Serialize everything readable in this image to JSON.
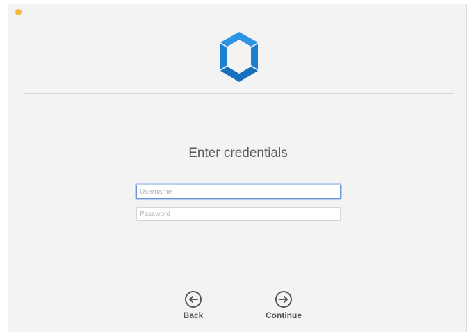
{
  "window": {
    "traffic_light_color": "#f6b93a"
  },
  "brand": {
    "logo_icon": "hexagon-cube-logo-icon",
    "accent_color": "#1e84d6"
  },
  "form": {
    "title": "Enter credentials",
    "username_placeholder": "Username",
    "username_value": "",
    "password_placeholder": "Password",
    "password_value": ""
  },
  "navigation": {
    "back_label": "Back",
    "back_icon": "arrow-left-circle-icon",
    "continue_label": "Continue",
    "continue_icon": "arrow-right-circle-icon"
  }
}
